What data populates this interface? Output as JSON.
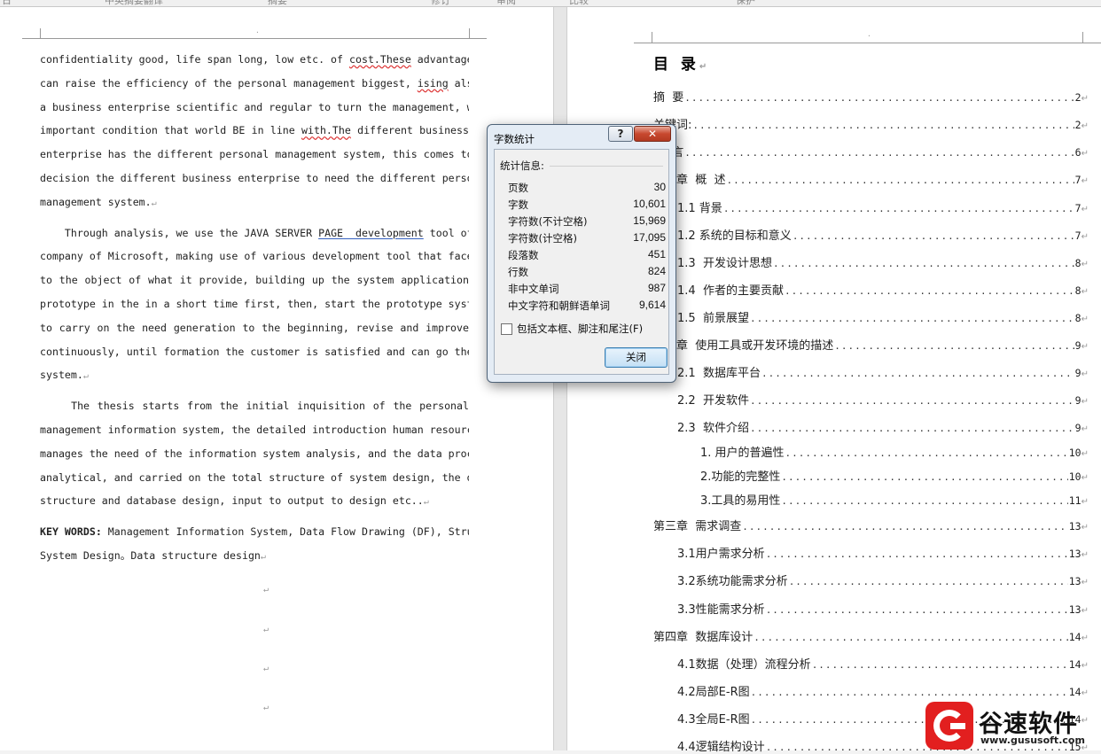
{
  "top_strip": [
    "日",
    "中英摘要翻译",
    "摘要",
    "修订",
    "审阅",
    "比较",
    "保护"
  ],
  "left_page": {
    "header_mark": "·",
    "paragraph_mark": "↵",
    "p1": {
      "l1a": "confidentiality good, life span long, low etc. of ",
      "l1b": "cost.These",
      "l1c": " advantages",
      "l2a": "can raise the efficiency of the personal management biggest, ",
      "l2b": "ising",
      "l2c": " also",
      "l3": "a business enterprise scientific and regular to turn the management, with",
      "l4a": "important condition that world BE in line ",
      "l4b": "with.The",
      "l4c": " different business",
      "l5": "enterprise has the different personal management system, this comes to a",
      "l6": "decision the different business enterprise to need the different personal",
      "l7": "management system."
    },
    "p2": {
      "l1a": "    Through analysis, we use the JAVA SERVER ",
      "l1b": "PAGE  development",
      "l1c": " tool of the",
      "l2": "company of Microsoft, making use of various development tool that faces",
      "l3": "to the object of what it provide, building up the system application",
      "l4": "prototype in the in a short time first, then, start the prototype system",
      "l5": "to carry on the need generation to the beginning, revise and improve",
      "l6": "continuously, until formation the customer is satisfied and can go the",
      "l7": "system."
    },
    "p3": {
      "l1": "    The thesis starts from the initial inquisition of the personal",
      "l2": "management information system, the detailed introduction human resource",
      "l3": "manages the need of the information system analysis, and the data process",
      "l4": "analytical, and carried on the total structure of system design, the data",
      "l5": "structure and database design, input to output to design etc.."
    },
    "keywords": {
      "label": "KEY WORDS:",
      "l1": " Management Information System, Data Flow Drawing (DF), Structural",
      "l2": "System Design。Data structure design"
    }
  },
  "toc": {
    "title": "目  录",
    "entries": [
      {
        "label": "摘  要",
        "page": "2"
      },
      {
        "label": "关键词:",
        "page": "2"
      },
      {
        "label": "引  言",
        "page": "6"
      },
      {
        "label": "第一章  概  述",
        "page": "7"
      },
      {
        "label": "1.1 背景",
        "page": "7"
      },
      {
        "label": "1.2 系统的目标和意义",
        "page": "7"
      },
      {
        "label": "1.3  开发设计思想",
        "page": "8"
      },
      {
        "label": "1.4  作者的主要贡献",
        "page": "8"
      },
      {
        "label": "1.5  前景展望",
        "page": "8"
      },
      {
        "label": "第二章  使用工具或开发环境的描述",
        "page": "9"
      },
      {
        "label": "2.1  数据库平台",
        "page": "9"
      },
      {
        "label": "2.2  开发软件",
        "page": "9"
      },
      {
        "label": "2.3  软件介绍",
        "page": "9"
      },
      {
        "label": "1. 用户的普遍性",
        "page": "10"
      },
      {
        "label": "2.功能的完整性",
        "page": "10"
      },
      {
        "label": "3.工具的易用性",
        "page": "11"
      },
      {
        "label": "第三章  需求调查",
        "page": "13"
      },
      {
        "label": "3.1用户需求分析",
        "page": "13"
      },
      {
        "label": "3.2系统功能需求分析",
        "page": "13"
      },
      {
        "label": "3.3性能需求分析",
        "page": "13"
      },
      {
        "label": "第四章  数据库设计",
        "page": "14"
      },
      {
        "label": "4.1数据（处理）流程分析",
        "page": "14"
      },
      {
        "label": "4.2局部E-R图",
        "page": "14"
      },
      {
        "label": "4.3全局E-R图",
        "page": "14"
      },
      {
        "label": "4.4逻辑结构设计",
        "page": "15"
      }
    ]
  },
  "dialog": {
    "title": "字数统计",
    "help_label": "?",
    "close_x_label": "✕",
    "group_label": "统计信息:",
    "stats": [
      {
        "label": "页数",
        "value": "30"
      },
      {
        "label": "字数",
        "value": "10,601"
      },
      {
        "label": "字符数(不计空格)",
        "value": "15,969"
      },
      {
        "label": "字符数(计空格)",
        "value": "17,095"
      },
      {
        "label": "段落数",
        "value": "451"
      },
      {
        "label": "行数",
        "value": "824"
      },
      {
        "label": "非中文单词",
        "value": "987"
      },
      {
        "label": "中文字符和朝鲜语单词",
        "value": "9,614"
      }
    ],
    "checkbox_label": "包括文本框、脚注和尾注(F)",
    "checkbox_checked": false,
    "close_button": "关闭"
  },
  "watermark": {
    "text": "谷速软件",
    "url": "www.gususoft.com",
    "brand_color": "#e21f1f"
  }
}
